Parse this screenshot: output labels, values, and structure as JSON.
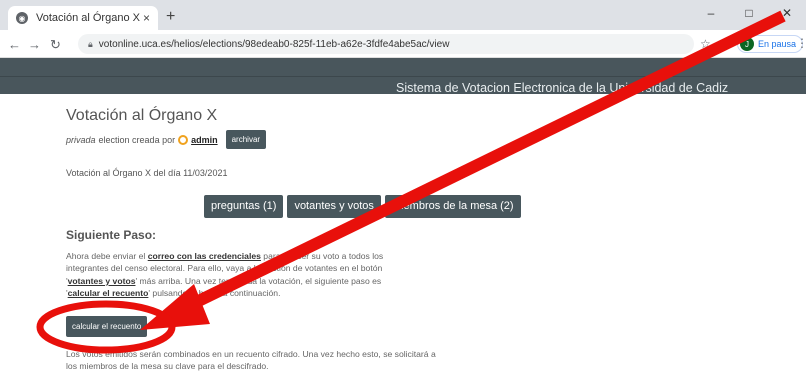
{
  "browser": {
    "tab_title": "Votación al Órgano X",
    "tab_close": "×",
    "new_tab": "+",
    "url": "votonline.uca.es/helios/elections/98edeab0-825f-11eb-a62e-3fdfe4abe5ac/view",
    "profile_initial": "J",
    "profile_status": "En pausa",
    "controls": {
      "minimize": "–",
      "maximize": "□",
      "close": "✕"
    }
  },
  "site": {
    "title": "Sistema de Votacion Electronica de la Universidad de Cadiz"
  },
  "election": {
    "title": "Votación al Órgano X",
    "visibility": "privada",
    "meta_text": "election creada por",
    "admin_label": "admin",
    "archive_label": "archivar",
    "description": "Votación al Órgano X del día 11/03/2021"
  },
  "actions": {
    "questions": "preguntas (1)",
    "voters": "votantes y votos",
    "trustees": "miembros de la mesa (2)"
  },
  "next_step": {
    "heading": "Siguiente Paso:",
    "para1_a": "Ahora debe enviar el ",
    "para1_link1": "correo con las credenciales",
    "para1_b": " para ejercer su voto a todos los integrantes del censo electoral. Para ello, vaya a la gestión de votantes en el botón '",
    "para1_link2": "votantes y votos",
    "para1_c": "' más arriba. Una vez terminada la votación, el siguiente paso es '",
    "para1_link3": "calcular el recuento",
    "para1_d": "' pulsando el botón a continuación.",
    "compute_button": "calcular el recuento",
    "para2": "Los votos emitidos serán combinados en un recuento cifrado. Una vez hecho esto, se solicitará a los miembros de la mesa su clave para el descifrado."
  },
  "annotation_colors": {
    "arrow": "#e8100b",
    "circle": "#e8100b"
  }
}
